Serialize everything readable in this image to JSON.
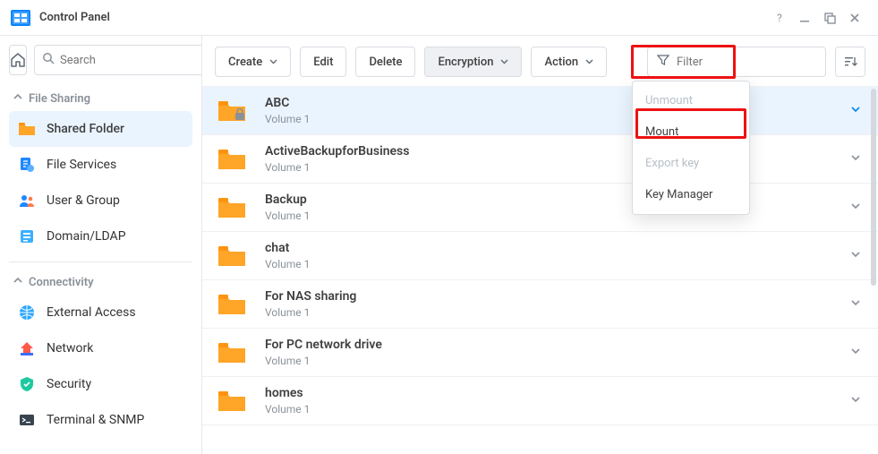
{
  "window": {
    "title": "Control Panel"
  },
  "sidebar": {
    "search_placeholder": "Search",
    "sections": {
      "file_sharing": {
        "label": "File Sharing",
        "items": [
          {
            "label": "Shared Folder",
            "id": "shared-folder"
          },
          {
            "label": "File Services",
            "id": "file-services"
          },
          {
            "label": "User & Group",
            "id": "user-group"
          },
          {
            "label": "Domain/LDAP",
            "id": "domain-ldap"
          }
        ]
      },
      "connectivity": {
        "label": "Connectivity",
        "items": [
          {
            "label": "External Access",
            "id": "external-access"
          },
          {
            "label": "Network",
            "id": "network"
          },
          {
            "label": "Security",
            "id": "security"
          },
          {
            "label": "Terminal & SNMP",
            "id": "terminal-snmp"
          }
        ]
      }
    }
  },
  "toolbar": {
    "create": "Create",
    "edit": "Edit",
    "delete": "Delete",
    "encryption": "Encryption",
    "action": "Action",
    "filter_placeholder": "Filter"
  },
  "encryption_menu": {
    "unmount": "Unmount",
    "mount": "Mount",
    "export_key": "Export key",
    "key_manager": "Key Manager"
  },
  "folders": [
    {
      "name": "ABC",
      "sub": "Volume 1",
      "encrypted": true,
      "selected": true
    },
    {
      "name": "ActiveBackupforBusiness",
      "sub": "Volume 1",
      "encrypted": false,
      "selected": false
    },
    {
      "name": "Backup",
      "sub": "Volume 1",
      "encrypted": false,
      "selected": false
    },
    {
      "name": "chat",
      "sub": "Volume 1",
      "encrypted": false,
      "selected": false
    },
    {
      "name": "For NAS sharing",
      "sub": "Volume 1",
      "encrypted": false,
      "selected": false
    },
    {
      "name": "For PC network drive",
      "sub": "Volume 1",
      "encrypted": false,
      "selected": false
    },
    {
      "name": "homes",
      "sub": "Volume 1",
      "encrypted": false,
      "selected": false
    }
  ]
}
